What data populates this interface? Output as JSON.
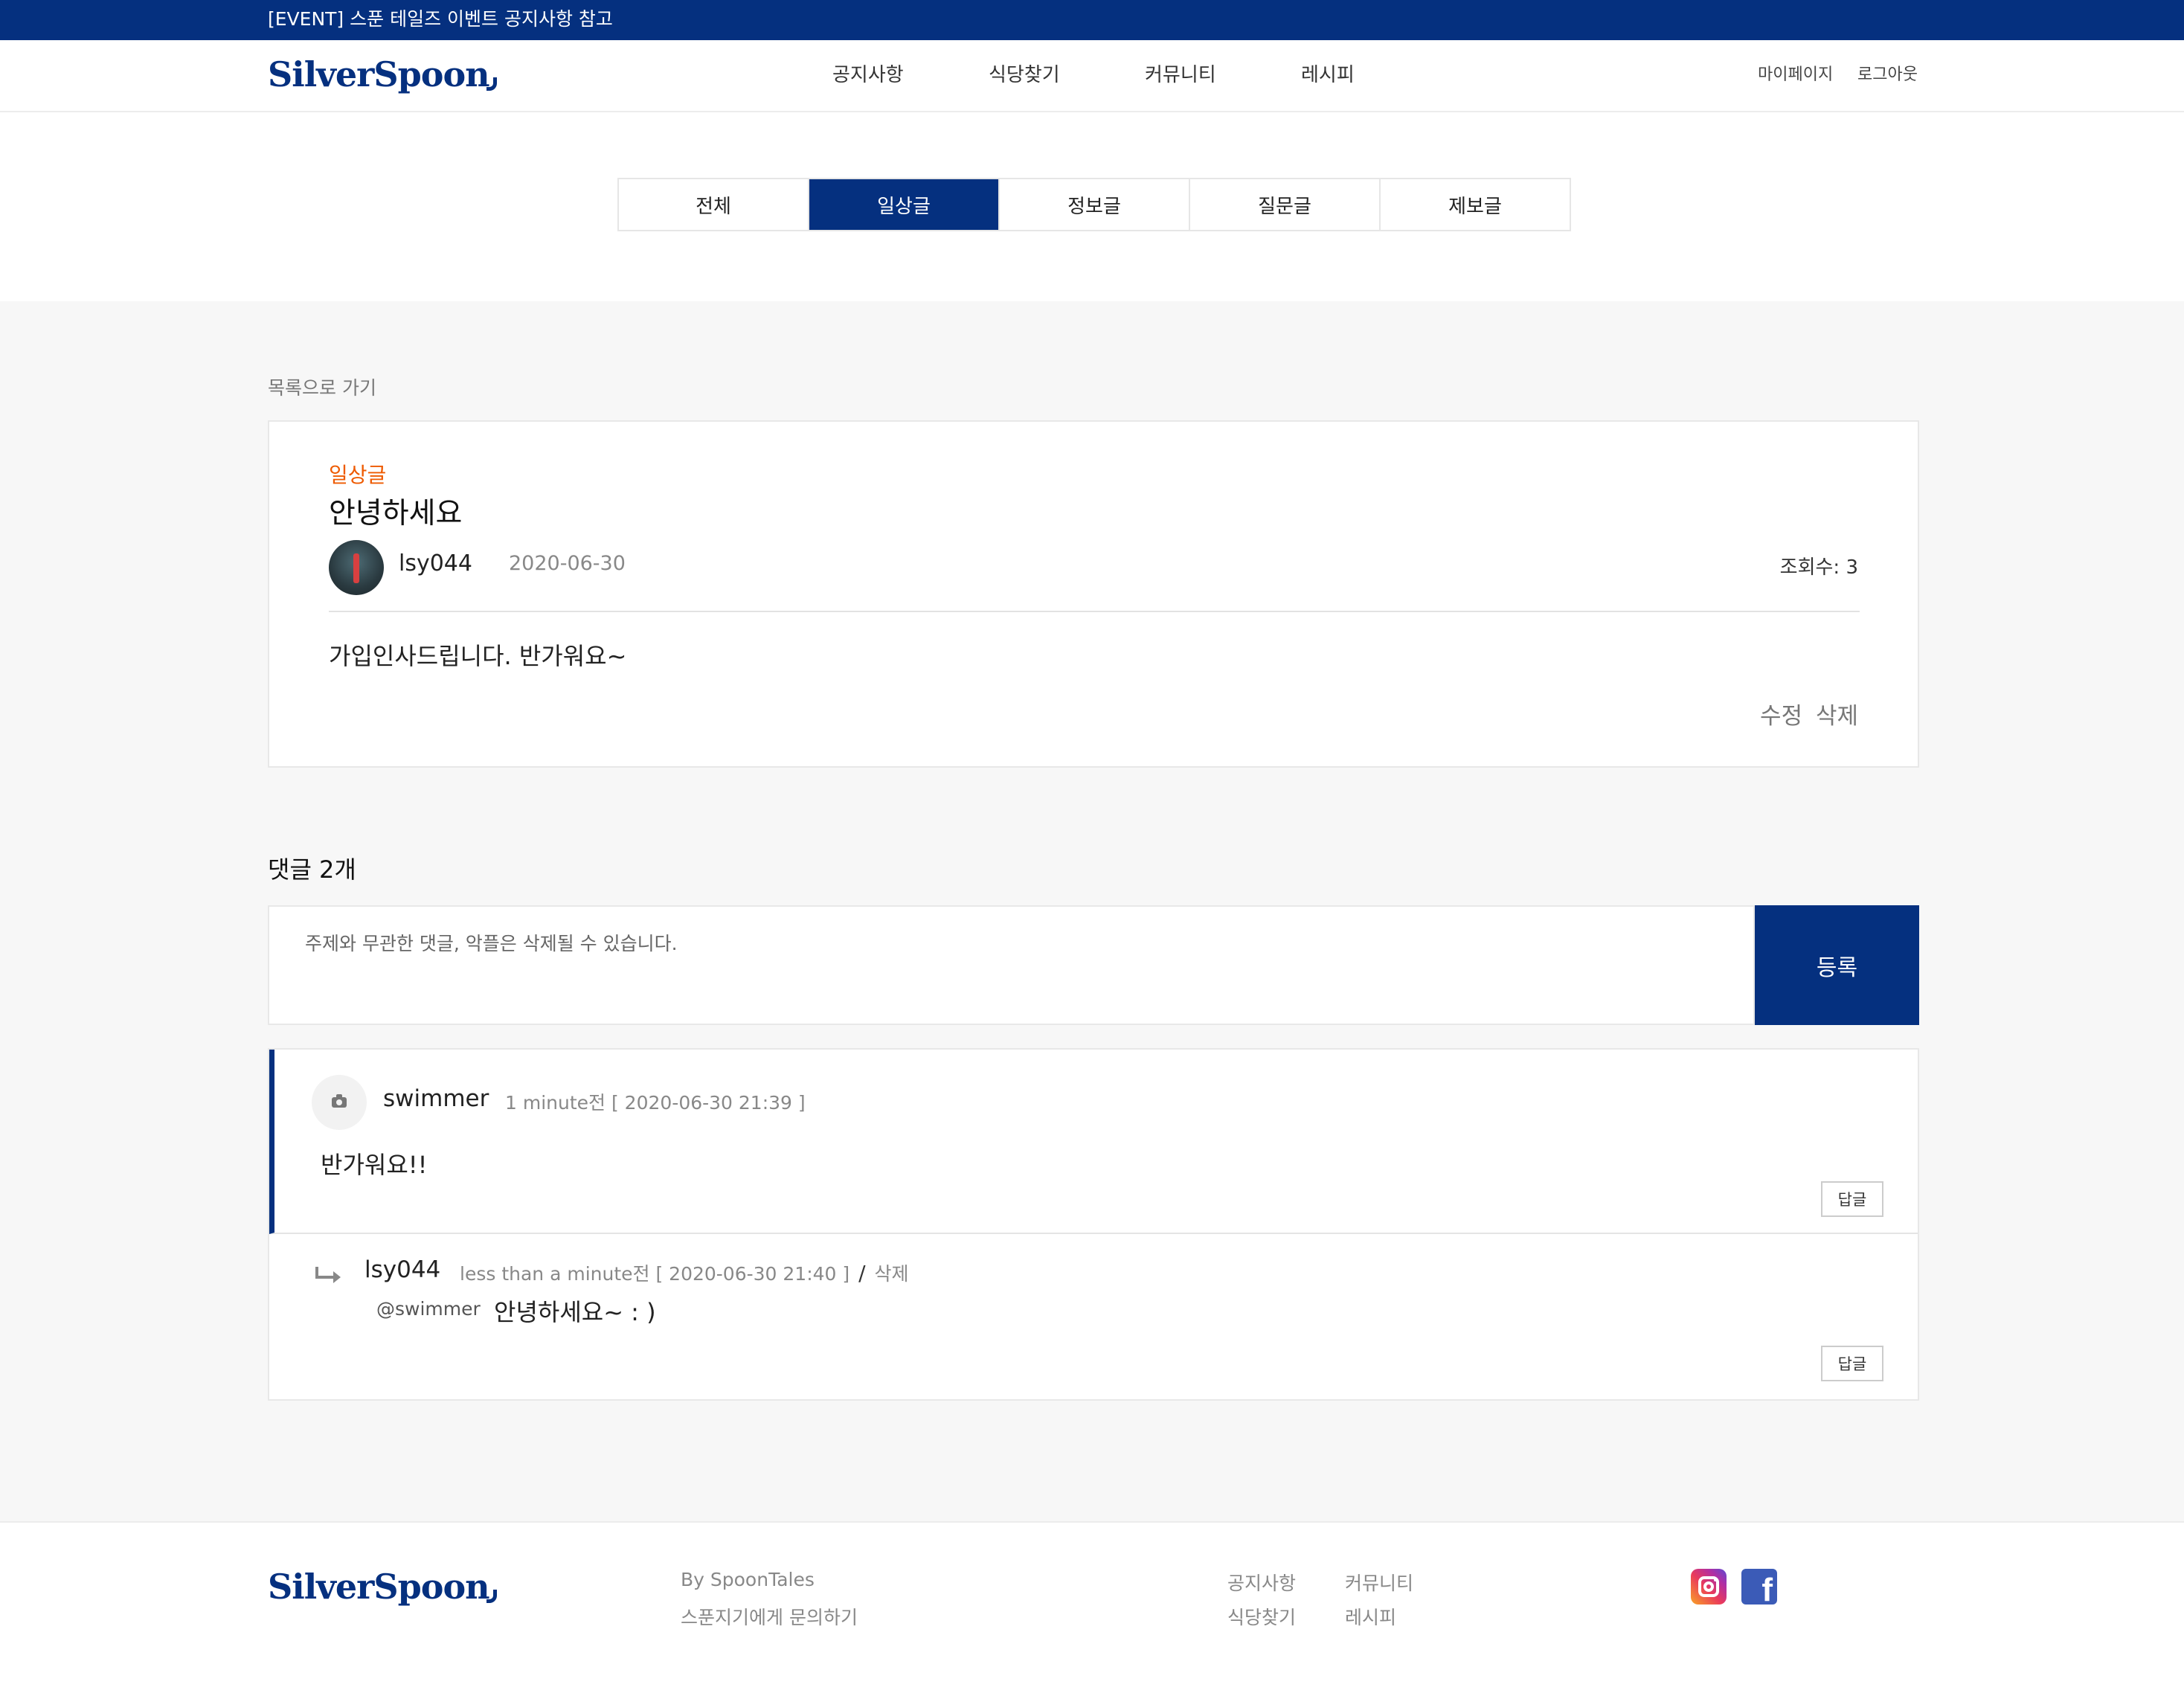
{
  "event_bar": {
    "text": "[EVENT] 스푼 테일즈 이벤트 공지사항 참고"
  },
  "header": {
    "logo": "SilverSpoon",
    "nav": [
      "공지사항",
      "식당찾기",
      "커뮤니티",
      "레시피"
    ],
    "user_links": {
      "mypage": "마이페이지",
      "logout": "로그아웃"
    }
  },
  "tabs": [
    {
      "label": "전체",
      "active": false
    },
    {
      "label": "일상글",
      "active": true
    },
    {
      "label": "정보글",
      "active": false
    },
    {
      "label": "질문글",
      "active": false
    },
    {
      "label": "제보글",
      "active": false
    }
  ],
  "back_link": "목록으로 가기",
  "post": {
    "category": "일상글",
    "title": "안녕하세요",
    "author": "lsy044",
    "date": "2020-06-30",
    "views": "조회수: 3",
    "body": "가입인사드립니다. 반가워요~",
    "edit": "수정",
    "delete": "삭제"
  },
  "comments_section": {
    "count_label": "댓글 2개",
    "input_placeholder": "주제와 무관한 댓글, 악플은 삭제될 수 있습니다.",
    "submit": "등록"
  },
  "comments": [
    {
      "author": "swimmer",
      "meta": "1 minute전 [ 2020-06-30 21:39 ]",
      "body": "반가워요!!",
      "reply_label": "답글",
      "avatar_icon": "camera-icon"
    }
  ],
  "replies": [
    {
      "author": "lsy044",
      "meta": "less than a minute전 [ 2020-06-30 21:40 ]",
      "separator": "/",
      "delete": "삭제",
      "mention": "@swimmer",
      "body": "안녕하세요~ : )",
      "reply_label": "답글"
    }
  ],
  "footer": {
    "logo": "SilverSpoon",
    "by": "By SpoonTales",
    "contact": "스푼지기에게 문의하기",
    "links": [
      "공지사항",
      "커뮤니티",
      "식당찾기",
      "레시피"
    ],
    "social": [
      "instagram-icon",
      "facebook-icon"
    ]
  },
  "colors": {
    "brand_navy": "#05307f",
    "category_orange": "#ee5a00",
    "background_gray": "#f7f7f7"
  }
}
